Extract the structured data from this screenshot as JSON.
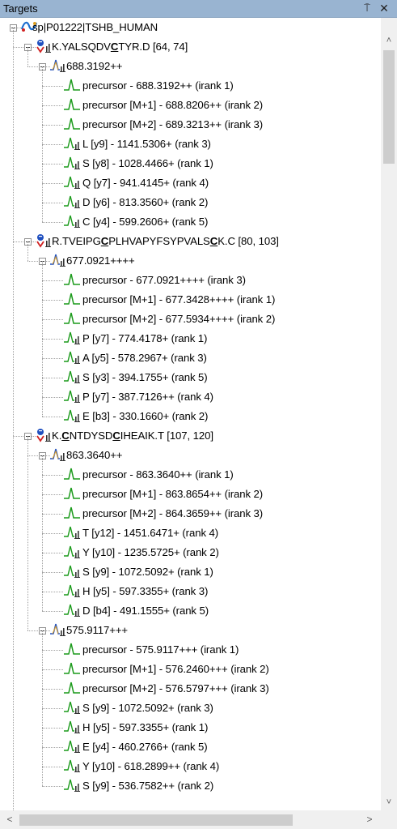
{
  "panel": {
    "title": "Targets",
    "pin_glyph": "⍑",
    "close_glyph": "✕"
  },
  "icons": {
    "protein": "protein-icon",
    "peptide": "peptide-icon",
    "precursor_charge": "precursor-charge-icon",
    "precursor_peak": "precursor-peak-icon",
    "fragment_ion": "fragment-ion-icon"
  },
  "colors": {
    "titlebar": "#99b4d1",
    "peak_green": "#1a9a1a",
    "peptide_red": "#d02020",
    "peptide_blue": "#2050c0",
    "protein_blue": "#1f6fd0"
  },
  "protein": {
    "name": "sp|P01222|TSHB_HUMAN"
  },
  "peptides": [
    {
      "label": {
        "pre": "K.YALSQDV",
        "mod1": "C",
        "post": "TYR.D [64, 74]"
      },
      "precursors": [
        {
          "mz": "688.3192++",
          "transitions": [
            "precursor - 688.3192++ (irank 1)",
            "precursor [M+1] - 688.8206++ (irank 2)",
            "precursor [M+2] - 689.3213++ (irank 3)",
            "L [y9] - 1141.5306+ (rank 3)",
            "S [y8] - 1028.4466+ (rank 1)",
            "Q [y7] - 941.4145+ (rank 4)",
            "D [y6] - 813.3560+ (rank 2)",
            "C [y4] - 599.2606+ (rank 5)"
          ]
        }
      ]
    },
    {
      "label": {
        "pre": "R.TVEIPG",
        "mod1": "C",
        "mid": "PLHVAPYFSYPVALS",
        "mod2": "C",
        "post": "K.C [80, 103]"
      },
      "precursors": [
        {
          "mz": "677.0921++++",
          "transitions": [
            "precursor - 677.0921++++ (irank 3)",
            "precursor [M+1] - 677.3428++++ (irank 1)",
            "precursor [M+2] - 677.5934++++ (irank 2)",
            "P [y7] - 774.4178+ (rank 1)",
            "A [y5] - 578.2967+ (rank 3)",
            "S [y3] - 394.1755+ (rank 5)",
            "P [y7] - 387.7126++ (rank 4)",
            "E [b3] - 330.1660+ (rank 2)"
          ]
        }
      ]
    },
    {
      "label": {
        "pre": "K.",
        "mod1": "C",
        "mid": "NTDYSD",
        "mod2": "C",
        "post": "IHEAIK.T [107, 120]"
      },
      "precursors": [
        {
          "mz": "863.3640++",
          "transitions": [
            "precursor - 863.3640++ (irank 1)",
            "precursor [M+1] - 863.8654++ (irank 2)",
            "precursor [M+2] - 864.3659++ (irank 3)",
            "T [y12] - 1451.6471+ (rank 4)",
            "Y [y10] - 1235.5725+ (rank 2)",
            "S [y9] - 1072.5092+ (rank 1)",
            "H [y5] - 597.3355+ (rank 3)",
            "D [b4] - 491.1555+ (rank 5)"
          ]
        },
        {
          "mz": "575.9117+++",
          "transitions": [
            "precursor - 575.9117+++ (irank 1)",
            "precursor [M+1] - 576.2460+++ (irank 2)",
            "precursor [M+2] - 576.5797+++ (irank 3)",
            "S [y9] - 1072.5092+ (rank 3)",
            "H [y5] - 597.3355+ (rank 1)",
            "E [y4] - 460.2766+ (rank 5)",
            "Y [y10] - 618.2899++ (rank 4)",
            "S [y9] - 536.7582++ (rank 2)"
          ]
        }
      ]
    }
  ],
  "scrollbars": {
    "up_glyph": "˄",
    "down_glyph": "˅",
    "left_glyph": "<",
    "right_glyph": ">"
  }
}
